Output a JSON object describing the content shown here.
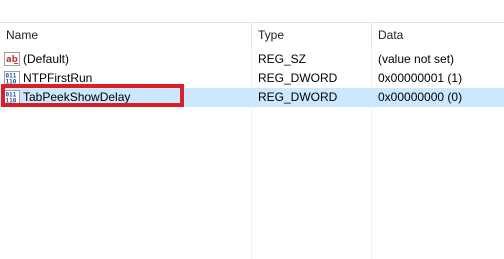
{
  "columns": {
    "name": "Name",
    "type": "Type",
    "data": "Data"
  },
  "rows": [
    {
      "name": "(Default)",
      "type": "REG_SZ",
      "data": "(value not set)",
      "icon": "string-value-icon"
    },
    {
      "name": "NTPFirstRun",
      "type": "REG_DWORD",
      "data": "0x00000001 (1)",
      "icon": "binary-value-icon"
    },
    {
      "name": "TabPeekShowDelay",
      "type": "REG_DWORD",
      "data": "0x00000000 (0)",
      "icon": "binary-value-icon"
    }
  ],
  "selected_row": "TabPeekShowDelay",
  "colors": {
    "selection": "#cce8ff",
    "highlight_box": "#d9202a",
    "string_icon": "#c0392b",
    "binary_icon": "#1f4e9c"
  }
}
